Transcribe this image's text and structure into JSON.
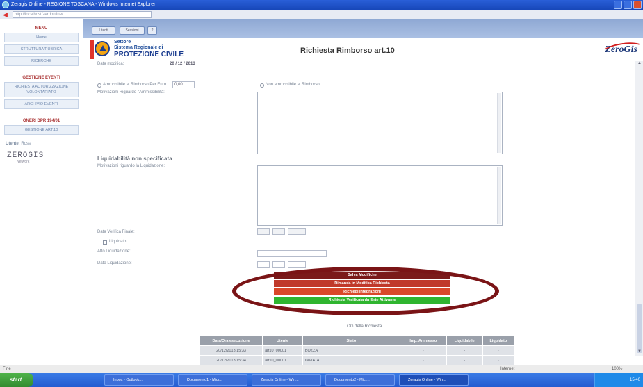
{
  "window": {
    "title": "Zeragis Online - REGIONE TOSCANA - Windows Internet Explorer",
    "address": "http://localhost/zerdonline/..."
  },
  "menu": {
    "head_menu": "MENU",
    "home": "Home",
    "struttura": "STRUTTURA/RUBRICA",
    "ricerche": "RICERCHE",
    "head_eventi": "GESTIONE EVENTI",
    "richiesta": "RICHIESTA AUTORIZZAZIONE VOLONTARIATO",
    "archivio": "ARCHIVIO EVENTI",
    "head_oneri": "ONERI DPR 194/01",
    "gestione": "GESTIONE ART.10",
    "user_label": "Utente:",
    "user_name": "Rossi",
    "logo_text": "ZEROGIS",
    "logo_sub": "Network"
  },
  "tabs": {
    "tab1": "Utenti",
    "tab2": "Sessioni",
    "tab3": "?"
  },
  "header": {
    "settore": "Settore",
    "sistema": "Sistema Regionale di",
    "protezione": "PROTEZIONE CIVILE",
    "title": "Richiesta Rimborso art.10",
    "brand": "ZeroGis"
  },
  "form": {
    "data_modifica_label": "Data modifica:",
    "data_modifica_value": "20 / 12 / 2013",
    "ammissibile_label": "Ammissibile al Rimborso Per Euro",
    "ammissibile_value": "0,00",
    "non_ammissibile_label": "Non ammissibile al Rimborso",
    "motivazioni_amm_label": "Motivazioni Riguardo l'Ammissibilità:",
    "liquidabilita_title": "Liquidabilità non specificata",
    "motivazioni_liq_label": "Motivazioni riguardo la Liquidazione:",
    "data_verifica_label": "Data Verifica Finale:",
    "liquidato_label": "Liquidato",
    "atto_label": "Atto Liquidazione:",
    "data_liq_label": "Data Liquidazione:"
  },
  "actions": {
    "salva": "Salva Modifiche",
    "rimanda": "Rimanda in Modifica Richiesta",
    "integrazioni": "Richiedi Integrazioni",
    "verificata": "Richiesta Verificata da Ente Attivante",
    "colors": {
      "salva": "#7b1a1a",
      "rimanda": "#c0392b",
      "integrazioni": "#d9482a",
      "verificata": "#2fb52f"
    }
  },
  "log": {
    "title": "LOG della Richiesta",
    "columns": [
      "Data/Ora esecuzione",
      "Utente",
      "Stato",
      "Imp. Ammesso",
      "Liquidabile",
      "Liquidato"
    ],
    "rows": [
      [
        "20/12/2013 15:33",
        "art10_00001",
        "BOZZA",
        "-",
        "-",
        "-"
      ],
      [
        "20/12/2013 15:34",
        "art10_00001",
        "INVIATA",
        "-",
        "-",
        "-"
      ]
    ]
  },
  "statusbar": {
    "left": "Fine",
    "zone": "Internet",
    "zoom": "100%"
  },
  "taskbar": {
    "start": "start",
    "items": [
      "Inbox - Outlook...",
      "Documento1 - Micr...",
      "Zeragis Online - Win...",
      "Documento2 - Micr...",
      "Zeragis Online - Win..."
    ],
    "clock": "15:40"
  }
}
